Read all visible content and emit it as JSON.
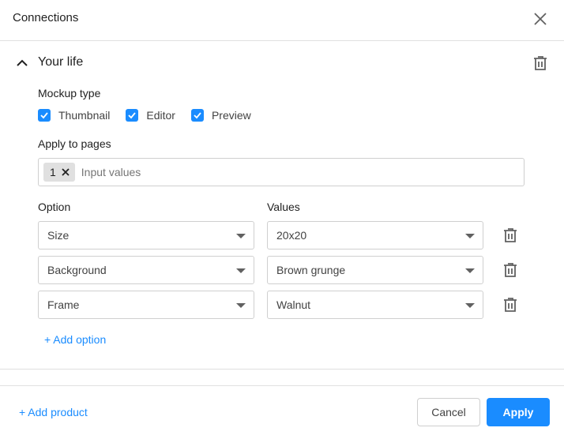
{
  "header": {
    "title": "Connections",
    "close_icon": "close-icon"
  },
  "section": {
    "title": "Your life",
    "collapse_icon": "chevron-up-icon",
    "delete_icon": "trash-icon"
  },
  "mockup": {
    "label": "Mockup type",
    "options": [
      {
        "label": "Thumbnail",
        "checked": true
      },
      {
        "label": "Editor",
        "checked": true
      },
      {
        "label": "Preview",
        "checked": true
      }
    ]
  },
  "pages": {
    "label": "Apply to pages",
    "chips": [
      "1"
    ],
    "placeholder": "Input values"
  },
  "options_table": {
    "option_header": "Option",
    "values_header": "Values",
    "rows": [
      {
        "option": "Size",
        "value": "20x20"
      },
      {
        "option": "Background",
        "value": "Brown grunge"
      },
      {
        "option": "Frame",
        "value": "Walnut"
      }
    ],
    "add_option_label": "+ Add option"
  },
  "footer": {
    "add_product_label": "+ Add product",
    "cancel_label": "Cancel",
    "apply_label": "Apply"
  },
  "colors": {
    "accent": "#1a8cff",
    "border": "#cfcfcf",
    "divider": "#e0e0e0"
  }
}
